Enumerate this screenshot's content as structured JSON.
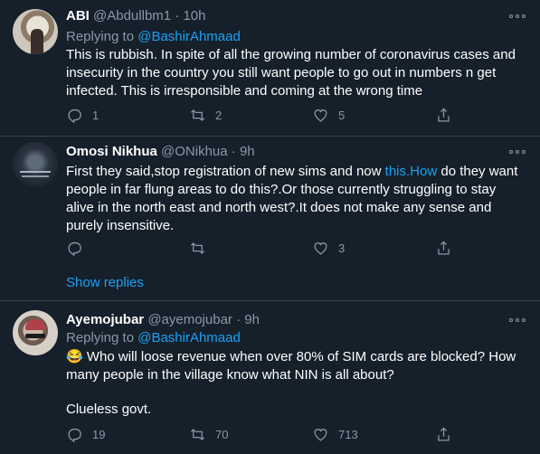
{
  "tweets": [
    {
      "name": "ABI",
      "handle": "@Abdullbm1",
      "time": "10h",
      "replying_prefix": "Replying to ",
      "replying_to": "@BashirAhmaad",
      "text": "This is rubbish. In spite of all the growing number of coronavirus cases and insecurity in the country you still want people to go out in numbers n get infected. This is irresponsible and coming at the wrong time",
      "replies": "1",
      "retweets": "2",
      "likes": "5"
    },
    {
      "name": "Omosi Nikhua",
      "handle": "@ONikhua",
      "time": "9h",
      "text_part1": "First they said,stop registration of new sims and now ",
      "text_link": "this.How",
      "text_part2": " do they want people in far flung areas to do this?.Or those currently struggling to stay alive in the north east and north west?.It does not make any sense and purely insensitive.",
      "replies": "",
      "retweets": "",
      "likes": "3",
      "show_replies": "Show replies"
    },
    {
      "name": "Ayemojubar",
      "handle": "@ayemojubar",
      "time": "9h",
      "replying_prefix": "Replying to ",
      "replying_to": "@BashirAhmaad",
      "emoji": "😂",
      "text": "Who will loose revenue when over 80% of SIM cards are blocked? How many people in the village know what NIN is all about?",
      "text2": "Clueless govt.",
      "replies": "19",
      "retweets": "70",
      "likes": "713"
    }
  ],
  "separator": "·",
  "colors": {
    "background": "#15202b",
    "secondary_text": "#8899a6",
    "link": "#1da1f2",
    "divider": "#38444d"
  },
  "icons": [
    "reply-icon",
    "retweet-icon",
    "like-icon",
    "share-icon",
    "more-icon"
  ]
}
